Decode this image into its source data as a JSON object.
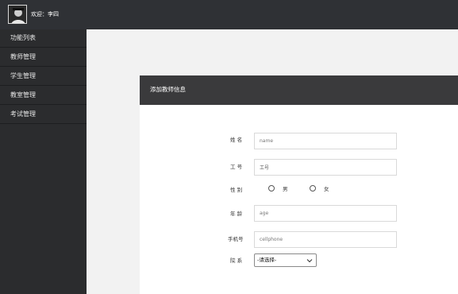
{
  "header": {
    "welcome_text": "欢迎：李四",
    "avatar_icon": "user-avatar-icon"
  },
  "sidebar": {
    "items": [
      {
        "label": "功能列表"
      },
      {
        "label": "教师管理"
      },
      {
        "label": "学生管理"
      },
      {
        "label": "教室管理"
      },
      {
        "label": "考试管理"
      }
    ]
  },
  "panel": {
    "title": "添加教师信息"
  },
  "form": {
    "name": {
      "label": "姓 名",
      "placeholder": "name",
      "value": ""
    },
    "employee_no": {
      "label": "工 号",
      "placeholder": "",
      "value": "工号"
    },
    "gender": {
      "label": "性 别",
      "options": [
        "男",
        "女"
      ]
    },
    "age": {
      "label": "年 龄",
      "placeholder": "age",
      "value": ""
    },
    "phone": {
      "label": "手机号",
      "placeholder": "cellphone",
      "value": ""
    },
    "department": {
      "label": "院 系",
      "selected": "-请选择-"
    }
  },
  "colors": {
    "topbar": "#2f3135",
    "sidebar": "#2b2c2e",
    "panel_header": "#3a3a3c",
    "background": "#f2f2f2"
  }
}
